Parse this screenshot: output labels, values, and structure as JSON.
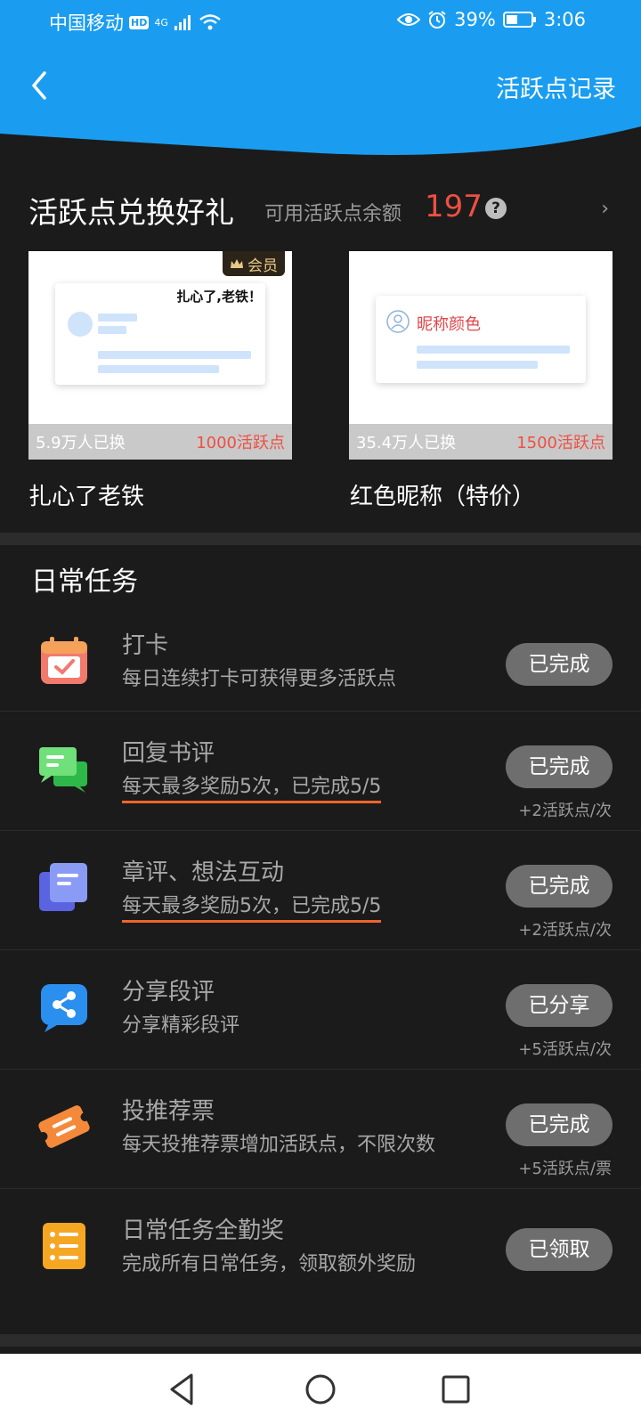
{
  "statusbar": {
    "carrier": "中国移动",
    "hd": "HD",
    "network": "4G",
    "battery": "39%",
    "time": "3:06"
  },
  "header": {
    "record_link": "活跃点记录"
  },
  "exchange": {
    "title": "活跃点兑换好礼",
    "balance_label": "可用活跃点余额",
    "balance": "197",
    "help": "?",
    "cards": [
      {
        "count": "5.9万人已换",
        "cost": "1000活跃点",
        "name": "扎心了老铁",
        "vip_tag": "会员",
        "preview_text": "扎心了,老铁！"
      },
      {
        "count": "35.4万人已换",
        "cost": "1500活跃点",
        "name": "红色昵称（特价）",
        "preview_text": "昵称颜色"
      }
    ]
  },
  "tasks": {
    "title": "日常任务",
    "items": [
      {
        "title": "打卡",
        "desc": "每日连续打卡可获得更多活跃点",
        "button": "已完成",
        "reward": ""
      },
      {
        "title": "回复书评",
        "desc": "每天最多奖励5次，已完成5/5",
        "button": "已完成",
        "reward": "+2活跃点/次"
      },
      {
        "title": "章评、想法互动",
        "desc": "每天最多奖励5次，已完成5/5",
        "button": "已完成",
        "reward": "+2活跃点/次"
      },
      {
        "title": "分享段评",
        "desc": "分享精彩段评",
        "button": "已分享",
        "reward": "+5活跃点/次"
      },
      {
        "title": "投推荐票",
        "desc": "每天投推荐票增加活跃点，不限次数",
        "button": "已完成",
        "reward": "+5活跃点/票"
      },
      {
        "title": "日常任务全勤奖",
        "desc": "完成所有日常任务，领取额外奖励",
        "button": "已领取",
        "reward": ""
      }
    ]
  },
  "colors": {
    "header_blue": "#1a9df0",
    "accent_red": "#ee4f43",
    "button_gray": "#6e6e6e",
    "underline_orange": "#f0642a"
  }
}
